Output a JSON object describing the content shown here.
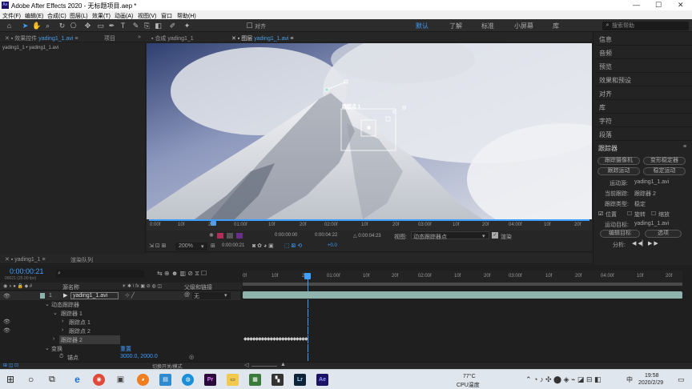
{
  "window": {
    "title": "Adobe After Effects 2020 - 无标题项目.aep *",
    "app_badge": "Ae"
  },
  "menu": [
    "文件(F)",
    "编辑(E)",
    "合成(C)",
    "图层(L)",
    "效果(T)",
    "动画(A)",
    "视图(V)",
    "窗口",
    "帮助(H)"
  ],
  "toolbar": {
    "align_label": "对齐",
    "search_placeholder": "搜索帮助"
  },
  "workspaces": [
    "默认",
    "了解",
    "标准",
    "小屏幕",
    "库"
  ],
  "left_panel": {
    "tab_effects": "效果控件",
    "tab_effects_target": "yading1_1.avi",
    "tab_project": "项目",
    "path": "yading1_1 • yading1_1.avi"
  },
  "viewer_tabs": {
    "comp_tab": "合成 yading1_1",
    "layer_prefix": "图层",
    "layer_name": "yading1_1.avi"
  },
  "tracker_label": "跟踪点 1",
  "viewer_ruler": [
    "0:00f",
    "10f",
    "20f",
    "01:00f",
    "10f",
    "20f",
    "02:00f",
    "10f",
    "20f",
    "03:00f",
    "10f",
    "20f",
    "04:00f",
    "10f",
    "20f"
  ],
  "viewer_bar1": {
    "t_in": "0:00:00:00",
    "t_out": "0:00:04:22",
    "t_dur": "△ 0:00:04:23",
    "view_label": "视图:",
    "view_value": "动态跟踪器点",
    "render_label": "渲染"
  },
  "viewer_bar2": {
    "zoom": "200%",
    "time": "0:00:00:21",
    "offset": "+0.0"
  },
  "right_panel": {
    "items": [
      "信息",
      "音频",
      "预览",
      "效果和预设",
      "对齐",
      "库",
      "字符",
      "段落"
    ],
    "tracker": {
      "title": "跟踪器",
      "btn_camera": "跟踪摄像机",
      "btn_warp": "变形稳定器",
      "btn_track": "跟踪运动",
      "btn_stabilize": "稳定运动",
      "source_label": "运动源:",
      "source_value": "yading1_1.avi",
      "current_label": "当前跟踪:",
      "current_value": "跟踪器 2",
      "type_label": "跟踪类型:",
      "type_value": "稳定",
      "chk_position": "位置",
      "chk_rotation": "旋转",
      "chk_scale": "缩放",
      "target_label": "运动目标:",
      "target_value": "yading1_1.avi",
      "btn_edit_target": "编辑目标",
      "btn_options": "选项",
      "analyze_label": "分析:"
    }
  },
  "timeline": {
    "comp_tab": "yading1_1",
    "render_tab": "渲染队列",
    "timecode": "0:00:00:21",
    "fps_info": "00021 (25.00 fps)",
    "col_source": "源名称",
    "col_parent": "父级和链接",
    "layer_index": "1",
    "layer_name": "yading1_1.avi",
    "parent_value": "无",
    "rows": [
      "动态跟踪器",
      "跟踪器 1",
      "跟踪点 1",
      "跟踪点 2",
      "跟踪器 2",
      "变换",
      "锚点"
    ],
    "reset_label": "重置",
    "anchor_value": "3000.0, 2000.0",
    "toggle_label": "切换开关/模式",
    "ruler": [
      "0f",
      "10f",
      "20f",
      "01:00f",
      "10f",
      "20f",
      "02:00f",
      "10f",
      "20f",
      "03:00f",
      "10f",
      "20f",
      "04:00f",
      "10f",
      "20f"
    ]
  },
  "taskbar": {
    "temp": "77°C",
    "temp_label": "CPU温度",
    "time": "19:58",
    "date": "2020/2/29",
    "lang": "中"
  },
  "colors": {
    "accent": "#3f9eff",
    "track_bar": "#8fb3ad",
    "tracker_box": "#ffffff"
  }
}
